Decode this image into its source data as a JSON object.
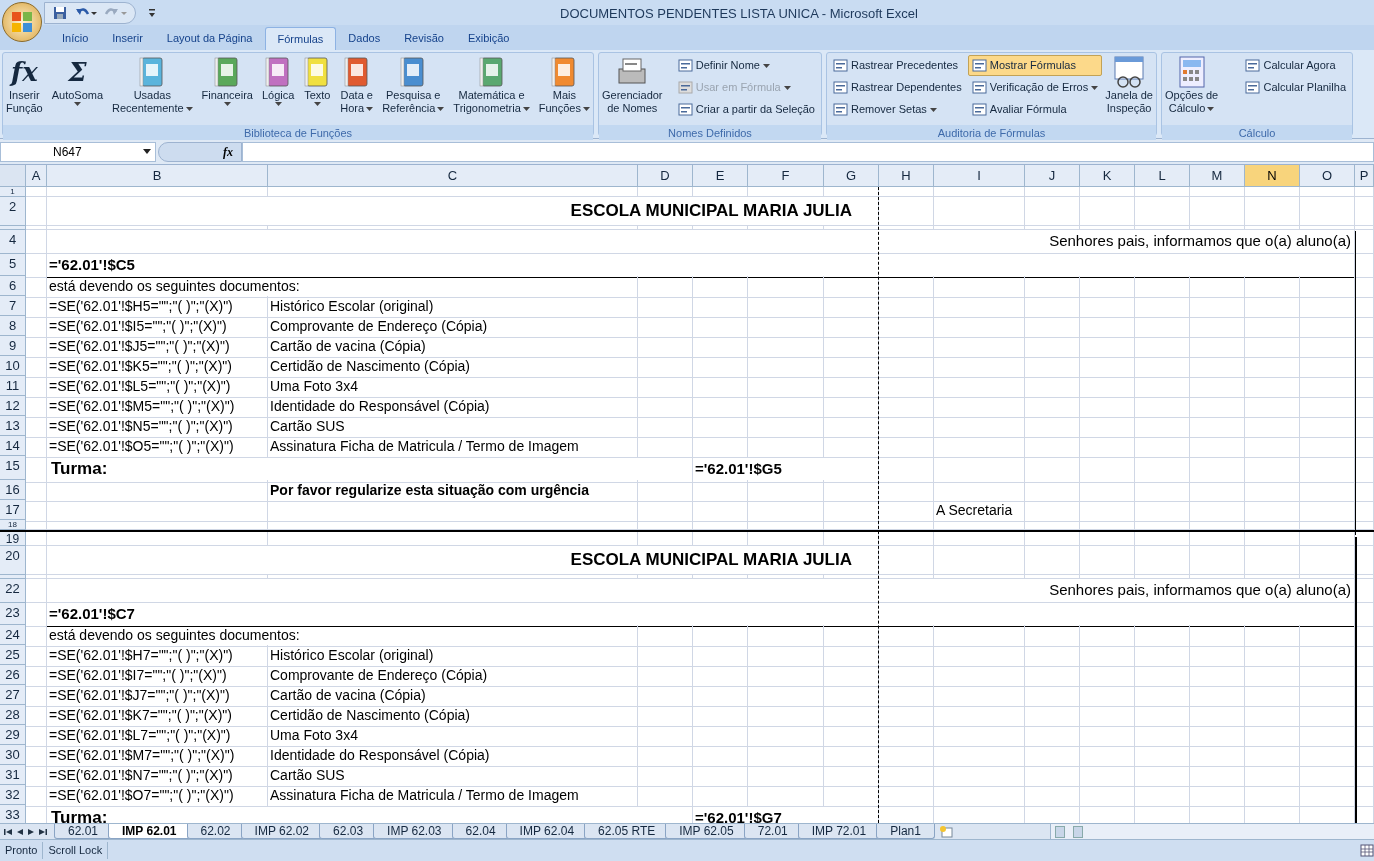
{
  "window": {
    "title": "DOCUMENTOS PENDENTES LISTA UNICA - Microsoft Excel"
  },
  "ribbon_tabs": [
    {
      "label": "Início",
      "selected": false
    },
    {
      "label": "Inserir",
      "selected": false
    },
    {
      "label": "Layout da Página",
      "selected": false
    },
    {
      "label": "Fórmulas",
      "selected": true
    },
    {
      "label": "Dados",
      "selected": false
    },
    {
      "label": "Revisão",
      "selected": false
    },
    {
      "label": "Exibição",
      "selected": false
    }
  ],
  "ribbon_groups": [
    {
      "caption": "Biblioteca de Funções",
      "items": [
        {
          "kind": "large",
          "glyph": "fx",
          "lines": [
            "Inserir",
            "Função"
          ],
          "dropdown": false
        },
        {
          "kind": "large",
          "glyph": "Σ",
          "lines": [
            "AutoSoma"
          ],
          "dropdown": true
        },
        {
          "kind": "large",
          "color": "#5ab4dc",
          "lines": [
            "Usadas",
            "Recentemente"
          ],
          "dropdown": true
        },
        {
          "kind": "large",
          "color": "#5aa85a",
          "lines": [
            "Financeira"
          ],
          "dropdown": true
        },
        {
          "kind": "large",
          "color": "#c070c0",
          "lines": [
            "Lógica"
          ],
          "dropdown": true
        },
        {
          "kind": "large",
          "color": "#f0e040",
          "lines": [
            "Texto"
          ],
          "dropdown": true
        },
        {
          "kind": "large",
          "color": "#e05a30",
          "lines": [
            "Data e",
            "Hora"
          ],
          "dropdown": true
        },
        {
          "kind": "large",
          "color": "#4a8ed0",
          "lines": [
            "Pesquisa e",
            "Referência"
          ],
          "dropdown": true
        },
        {
          "kind": "large",
          "color": "#5aa870",
          "lines": [
            "Matemática e",
            "Trigonometria"
          ],
          "dropdown": true
        },
        {
          "kind": "large",
          "color": "#f08a30",
          "lines": [
            "Mais",
            "Funções"
          ],
          "dropdown": true
        }
      ]
    },
    {
      "caption": "Nomes Definidos",
      "items": [
        {
          "kind": "large",
          "lines": [
            "Gerenciador",
            "de Nomes"
          ],
          "dropdown": false
        },
        {
          "kind": "small",
          "label": "Definir Nome",
          "dropdown": true,
          "disabled": false,
          "selected": false
        },
        {
          "kind": "small",
          "label": "Usar em Fórmula",
          "dropdown": true,
          "disabled": true,
          "selected": false
        },
        {
          "kind": "small",
          "label": "Criar a partir da Seleção",
          "dropdown": false,
          "disabled": false,
          "selected": false
        }
      ]
    },
    {
      "caption": "Auditoria de Fórmulas",
      "items": [
        {
          "kind": "small",
          "label": "Rastrear Precedentes",
          "dropdown": false,
          "disabled": false,
          "selected": false
        },
        {
          "kind": "small",
          "label": "Rastrear Dependentes",
          "dropdown": false,
          "disabled": false,
          "selected": false
        },
        {
          "kind": "small",
          "label": "Remover Setas",
          "dropdown": true,
          "disabled": false,
          "selected": false
        },
        {
          "kind": "small",
          "label": "Mostrar Fórmulas",
          "dropdown": false,
          "disabled": false,
          "selected": true
        },
        {
          "kind": "small",
          "label": "Verificação de Erros",
          "dropdown": true,
          "disabled": false,
          "selected": false
        },
        {
          "kind": "small",
          "label": "Avaliar Fórmula",
          "dropdown": false,
          "disabled": false,
          "selected": false
        },
        {
          "kind": "large",
          "lines": [
            "Janela de",
            "Inspeção"
          ],
          "dropdown": false
        }
      ]
    },
    {
      "caption": "Cálculo",
      "items": [
        {
          "kind": "large",
          "lines": [
            "Opções de",
            "Cálculo"
          ],
          "dropdown": true
        },
        {
          "kind": "small",
          "label": "Calcular Agora",
          "dropdown": false,
          "disabled": false,
          "selected": false
        },
        {
          "kind": "small",
          "label": "Calcular Planilha",
          "dropdown": false,
          "disabled": false,
          "selected": false
        }
      ]
    }
  ],
  "formula_bar": {
    "name_box": "N647",
    "fx": "fx"
  },
  "columns": [
    {
      "label": "A",
      "selected": false
    },
    {
      "label": "B",
      "selected": false
    },
    {
      "label": "C",
      "selected": false
    },
    {
      "label": "D",
      "selected": false
    },
    {
      "label": "E",
      "selected": false
    },
    {
      "label": "F",
      "selected": false
    },
    {
      "label": "G",
      "selected": false
    },
    {
      "label": "H",
      "selected": false
    },
    {
      "label": "I",
      "selected": false
    },
    {
      "label": "J",
      "selected": false
    },
    {
      "label": "K",
      "selected": false
    },
    {
      "label": "L",
      "selected": false
    },
    {
      "label": "M",
      "selected": false
    },
    {
      "label": "N",
      "selected": true
    },
    {
      "label": "O",
      "selected": false
    },
    {
      "label": "P",
      "selected": false
    }
  ],
  "rows": [
    {
      "number": "1",
      "kind": "thin"
    },
    {
      "number": "2",
      "kind": "title",
      "text": "ESCOLA MUNICIPAL MARIA JULIA"
    },
    {
      "kind": "hair"
    },
    {
      "number": "4",
      "kind": "greeting",
      "text": "Senhores pais, informamos que o(a) aluno(a)"
    },
    {
      "number": "5",
      "kind": "student",
      "text": "='62.01'!$C5"
    },
    {
      "number": "6",
      "kind": "intro",
      "text": "está devendo os seguintes documentos:"
    },
    {
      "number": "7",
      "kind": "item",
      "formula": "=SE('62.01'!$H5=\"\";\"(  )\";\"(X)\")",
      "document": "Histórico Escolar (original)"
    },
    {
      "number": "8",
      "kind": "item",
      "formula": "=SE('62.01'!$I5=\"\";\"(  )\";\"(X)\")",
      "document": "Comprovante de Endereço (Cópia)"
    },
    {
      "number": "9",
      "kind": "item",
      "formula": "=SE('62.01'!$J5=\"\";\"(  )\";\"(X)\")",
      "document": "Cartão de vacina (Cópia)"
    },
    {
      "number": "10",
      "kind": "item",
      "formula": "=SE('62.01'!$K5=\"\";\"(  )\";\"(X)\")",
      "document": "Certidão de Nascimento (Cópia)"
    },
    {
      "number": "11",
      "kind": "item",
      "formula": "=SE('62.01'!$L5=\"\";\"(  )\";\"(X)\")",
      "document": "Uma Foto 3x4"
    },
    {
      "number": "12",
      "kind": "item",
      "formula": "=SE('62.01'!$M5=\"\";\"(  )\";\"(X)\")",
      "document": "Identidade do Responsável (Cópia)"
    },
    {
      "number": "13",
      "kind": "item",
      "formula": "=SE('62.01'!$N5=\"\";\"(  )\";\"(X)\")",
      "document": "Cartão SUS"
    },
    {
      "number": "14",
      "kind": "item",
      "formula": "=SE('62.01'!$O5=\"\";\"(  )\";\"(X)\")",
      "document": "Assinatura Ficha de Matricula / Termo de Imagem"
    },
    {
      "number": "15",
      "kind": "turma",
      "label": "Turma:",
      "value": "='62.01'!$G5"
    },
    {
      "number": "16",
      "kind": "notice",
      "text": "Por favor regularize esta situação com urgência"
    },
    {
      "number": "17",
      "kind": "signature",
      "text": "A Secretaria"
    },
    {
      "number": "18",
      "kind": "thin"
    },
    {
      "number": "19",
      "kind": "break"
    },
    {
      "number": "20",
      "kind": "title",
      "text": "ESCOLA MUNICIPAL MARIA JULIA"
    },
    {
      "kind": "hair"
    },
    {
      "number": "22",
      "kind": "greeting",
      "text": "Senhores pais, informamos que o(a) aluno(a)"
    },
    {
      "number": "23",
      "kind": "student",
      "text": "='62.01'!$C7"
    },
    {
      "number": "24",
      "kind": "intro",
      "text": "está devendo os seguintes documentos:"
    },
    {
      "number": "25",
      "kind": "item",
      "formula": "=SE('62.01'!$H7=\"\";\"(  )\";\"(X)\")",
      "document": "Histórico Escolar (original)"
    },
    {
      "number": "26",
      "kind": "item",
      "formula": "=SE('62.01'!$I7=\"\";\"(  )\";\"(X)\")",
      "document": "Comprovante de Endereço (Cópia)"
    },
    {
      "number": "27",
      "kind": "item",
      "formula": "=SE('62.01'!$J7=\"\";\"(  )\";\"(X)\")",
      "document": "Cartão de vacina (Cópia)"
    },
    {
      "number": "28",
      "kind": "item",
      "formula": "=SE('62.01'!$K7=\"\";\"(  )\";\"(X)\")",
      "document": "Certidão de Nascimento (Cópia)"
    },
    {
      "number": "29",
      "kind": "item",
      "formula": "=SE('62.01'!$L7=\"\";\"(  )\";\"(X)\")",
      "document": "Uma Foto 3x4"
    },
    {
      "number": "30",
      "kind": "item",
      "formula": "=SE('62.01'!$M7=\"\";\"(  )\";\"(X)\")",
      "document": "Identidade do Responsável (Cópia)"
    },
    {
      "number": "31",
      "kind": "item",
      "formula": "=SE('62.01'!$N7=\"\";\"(  )\";\"(X)\")",
      "document": "Cartão SUS"
    },
    {
      "number": "32",
      "kind": "item",
      "formula": "=SE('62.01'!$O7=\"\";\"(  )\";\"(X)\")",
      "document": "Assinatura Ficha de Matricula / Termo de Imagem"
    },
    {
      "number": "33",
      "kind": "turma",
      "label": "Turma:",
      "value": "='62.01'!$G7"
    }
  ],
  "sheet_tabs": [
    {
      "label": "62.01",
      "selected": false
    },
    {
      "label": "IMP 62.01",
      "selected": true
    },
    {
      "label": "62.02",
      "selected": false
    },
    {
      "label": "IMP 62.02",
      "selected": false
    },
    {
      "label": "62.03",
      "selected": false
    },
    {
      "label": "IMP 62.03",
      "selected": false
    },
    {
      "label": "62.04",
      "selected": false
    },
    {
      "label": "IMP 62.04",
      "selected": false
    },
    {
      "label": "62.05 RTE",
      "selected": false
    },
    {
      "label": "IMP 62.05",
      "selected": false
    },
    {
      "label": "72.01",
      "selected": false
    },
    {
      "label": "IMP 72.01",
      "selected": false
    },
    {
      "label": "Plan1",
      "selected": false
    }
  ],
  "status_bar": [
    "Pronto",
    "Scroll Lock"
  ]
}
